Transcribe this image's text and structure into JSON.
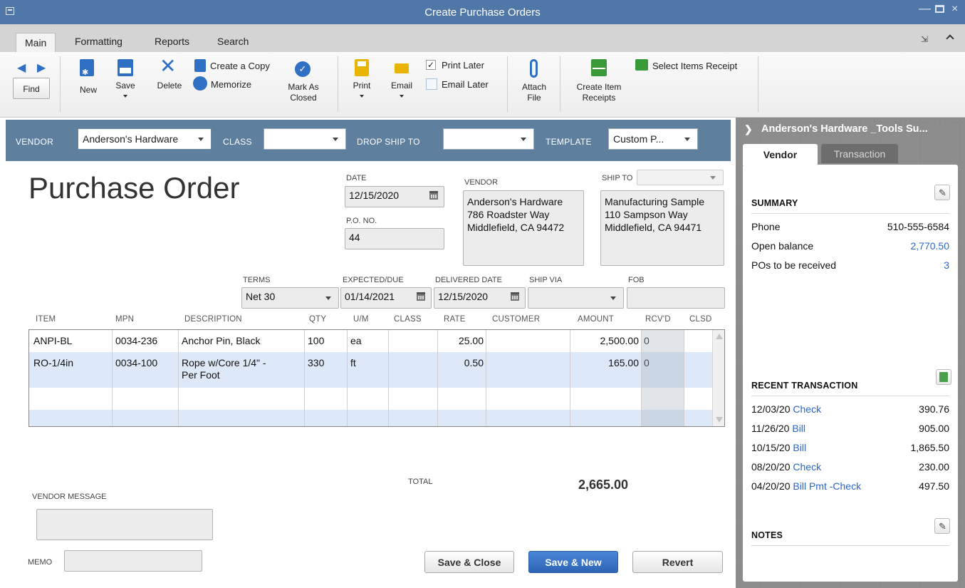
{
  "window": {
    "title": "Create Purchase Orders"
  },
  "tabs": [
    "Main",
    "Formatting",
    "Reports",
    "Search"
  ],
  "ribbon": {
    "find": "Find",
    "new": "New",
    "save": "Save",
    "delete": "Delete",
    "create_copy": "Create a Copy",
    "memorize": "Memorize",
    "mark_closed_1": "Mark As",
    "mark_closed_2": "Closed",
    "print": "Print",
    "email": "Email",
    "print_later": "Print Later",
    "print_later_checked": true,
    "email_later": "Email Later",
    "email_later_checked": false,
    "attach_1": "Attach",
    "attach_2": "File",
    "create_receipts_1": "Create Item",
    "create_receipts_2": "Receipts",
    "select_items": "Select Items Receipt"
  },
  "header": {
    "vendor_label": "VENDOR",
    "vendor_value": "Anderson's Hardware",
    "class_label": "CLASS",
    "class_value": "",
    "dropship_label": "DROP SHIP TO",
    "dropship_value": "",
    "template_label": "TEMPLATE",
    "template_value": "Custom P..."
  },
  "form": {
    "title": "Purchase Order",
    "date_label": "DATE",
    "date_value": "12/15/2020",
    "po_label": "P.O. NO.",
    "po_value": "44",
    "vendor_label": "VENDOR",
    "vendor_addr": [
      "Anderson's Hardware",
      "786 Roadster Way",
      "Middlefield, CA 94472"
    ],
    "shipto_label": "SHIP TO",
    "shipto_addr": [
      "Manufacturing Sample",
      "110 Sampson Way",
      "Middlefield, CA 94471"
    ],
    "terms_label": "TERMS",
    "terms_value": "Net 30",
    "expected_label": "EXPECTED/DUE",
    "expected_value": "01/14/2021",
    "delivered_label": "DELIVERED DATE",
    "delivered_value": "12/15/2020",
    "shipvia_label": "SHIP VIA",
    "shipvia_value": "",
    "fob_label": "FOB",
    "fob_value": ""
  },
  "grid": {
    "headers": [
      "ITEM",
      "MPN",
      "DESCRIPTION",
      "QTY",
      "U/M",
      "CLASS",
      "RATE",
      "CUSTOMER",
      "AMOUNT",
      "RCV'D",
      "CLSD"
    ],
    "rows": [
      {
        "item": "ANPI-BL",
        "mpn": "0034-236",
        "desc1": "Anchor Pin, Black",
        "desc2": "",
        "qty": "100",
        "um": "ea",
        "class": "",
        "rate": "25.00",
        "customer": "",
        "amount": "2,500.00",
        "rcvd": "0"
      },
      {
        "item": "RO-1/4in",
        "mpn": "0034-100",
        "desc1": "Rope w/Core 1/4\" -",
        "desc2": "Per Foot",
        "qty": "330",
        "um": "ft",
        "class": "",
        "rate": "0.50",
        "customer": "",
        "amount": "165.00",
        "rcvd": "0"
      }
    ]
  },
  "footer": {
    "total_label": "TOTAL",
    "total_value": "2,665.00",
    "vendor_message_label": "VENDOR MESSAGE",
    "memo_label": "MEMO",
    "save_close": "Save & Close",
    "save_new": "Save & New",
    "revert": "Revert"
  },
  "sidepanel": {
    "title": "Anderson's Hardware _Tools Su...",
    "tab_vendor": "Vendor",
    "tab_transaction": "Transaction",
    "summary_label": "SUMMARY",
    "summary": [
      {
        "label": "Phone",
        "value": "510-555-6584",
        "link": false
      },
      {
        "label": "Open balance",
        "value": "2,770.50",
        "link": true
      },
      {
        "label": "POs to be received",
        "value": "3",
        "link": true
      }
    ],
    "recent_label": "RECENT TRANSACTION",
    "recent": [
      {
        "date": "12/03/20",
        "type": "Check",
        "amount": "390.76"
      },
      {
        "date": "11/26/20",
        "type": "Bill",
        "amount": "905.00"
      },
      {
        "date": "10/15/20",
        "type": "Bill",
        "amount": "1,865.50"
      },
      {
        "date": "08/20/20",
        "type": "Check",
        "amount": "230.00"
      },
      {
        "date": "04/20/20",
        "type": "Bill Pmt -Check",
        "amount": "497.50"
      }
    ],
    "notes_label": "NOTES"
  }
}
